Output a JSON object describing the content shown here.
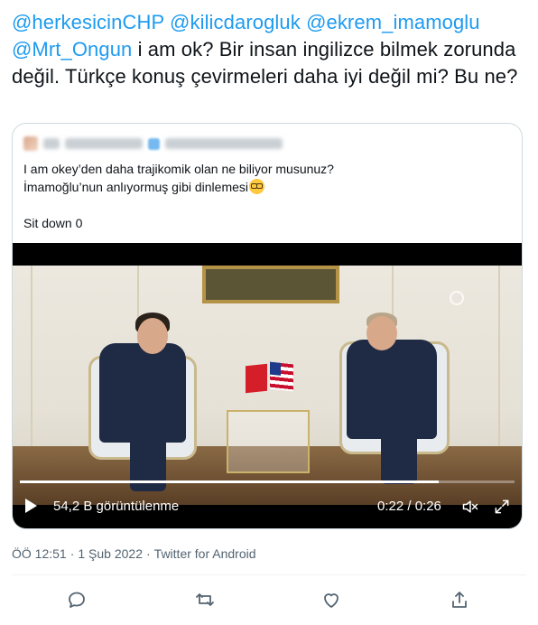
{
  "tweet": {
    "mentions": [
      "@herkesicinCHP",
      "@kilicdarogluk",
      "@ekrem_imamoglu",
      "@Mrt_Ongun"
    ],
    "text_part1": " i am ok? Bir insan ingilizce bilmek zorunda değil. Türkçe konuş çevirmeleri daha iyi değil mi? Bu ne?"
  },
  "quote": {
    "line1": "I am okey’den daha trajikomik olan ne biliyor musunuz?",
    "line2": "İmamoğlu’nun anlıyormuş gibi dinlemesi",
    "emoji_name": "nerd-face-icon",
    "line3": "Sit down 0"
  },
  "video": {
    "views": "54,2 B görüntülenme",
    "time": "0:22 / 0:26",
    "progress_fraction": 0.846
  },
  "meta": {
    "time": "ÖÖ 12:51",
    "date": "1 Şub 2022",
    "source": "Twitter for Android"
  },
  "icons": {
    "reply": "reply-icon",
    "retweet": "retweet-icon",
    "like": "like-icon",
    "share": "share-icon"
  },
  "colors": {
    "accent": "#1d9bf0",
    "text": "#0f1419",
    "muted": "#536471",
    "border": "#cfd9de"
  }
}
